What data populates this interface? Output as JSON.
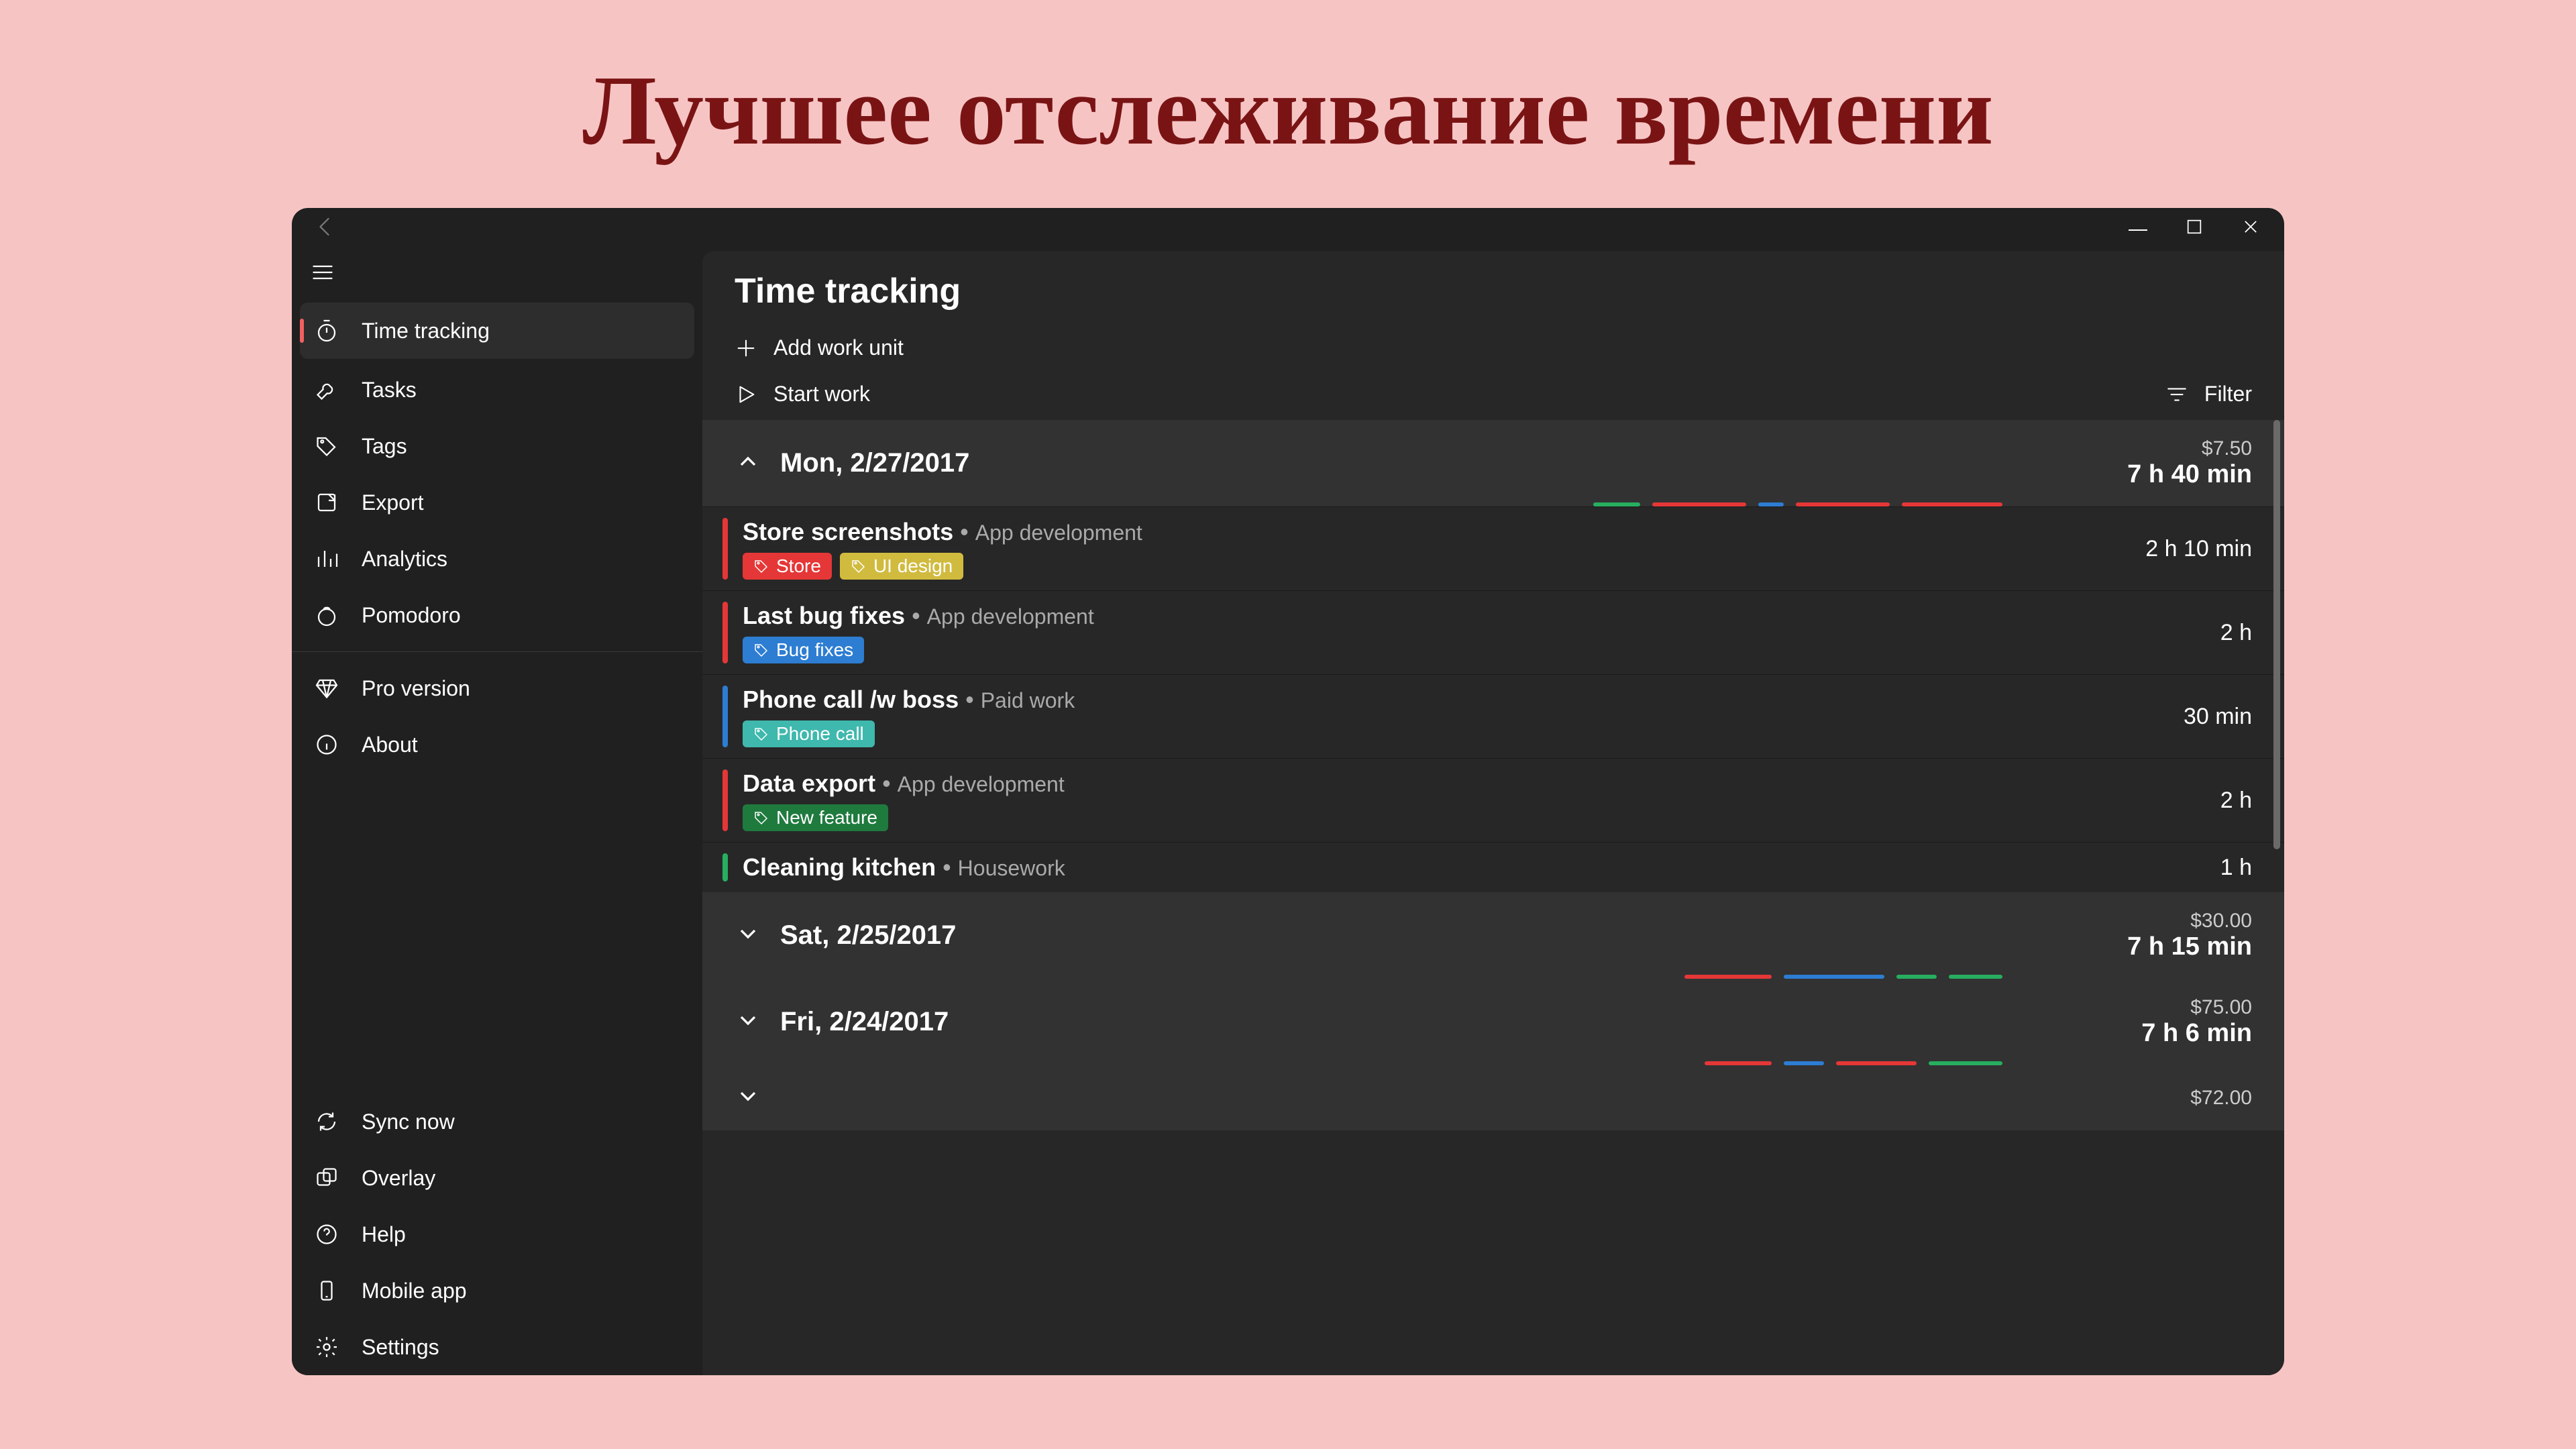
{
  "page_heading": "Лучшее отслеживание времени",
  "sidebar": {
    "main_nav": [
      {
        "id": "time-tracking",
        "label": "Time tracking",
        "icon": "stopwatch"
      },
      {
        "id": "tasks",
        "label": "Tasks",
        "icon": "wrench"
      },
      {
        "id": "tags",
        "label": "Tags",
        "icon": "tag"
      },
      {
        "id": "export",
        "label": "Export",
        "icon": "export"
      },
      {
        "id": "analytics",
        "label": "Analytics",
        "icon": "bars"
      },
      {
        "id": "pomodoro",
        "label": "Pomodoro",
        "icon": "pomodoro"
      }
    ],
    "secondary_nav": [
      {
        "id": "pro",
        "label": "Pro version",
        "icon": "diamond"
      },
      {
        "id": "about",
        "label": "About",
        "icon": "info"
      }
    ],
    "bottom_nav": [
      {
        "id": "sync",
        "label": "Sync now",
        "icon": "sync"
      },
      {
        "id": "overlay",
        "label": "Overlay",
        "icon": "overlay"
      },
      {
        "id": "help",
        "label": "Help",
        "icon": "help"
      },
      {
        "id": "mobile",
        "label": "Mobile app",
        "icon": "phone"
      },
      {
        "id": "settings",
        "label": "Settings",
        "icon": "gear"
      }
    ]
  },
  "main": {
    "title": "Time tracking",
    "add_work_unit": "Add work unit",
    "start_work": "Start work",
    "filter": "Filter"
  },
  "colors": {
    "red": "#e53737",
    "yellow": "#d1bb3f",
    "blue": "#2d7dd2",
    "teal": "#3fb8ad",
    "darkgreen": "#1f7a3e",
    "green": "#27ae60"
  },
  "days": [
    {
      "expanded": true,
      "date": "Mon, 2/27/2017",
      "price": "$7.50",
      "duration": "7 h 40 min",
      "bars": [
        {
          "color": "green",
          "w": 70
        },
        {
          "color": "red",
          "w": 140
        },
        {
          "color": "blue",
          "w": 38
        },
        {
          "color": "red",
          "w": 140
        },
        {
          "color": "red",
          "w": 150
        }
      ],
      "entries": [
        {
          "stripe": "red",
          "title": "Store screenshots",
          "project": "App development",
          "duration": "2 h 10 min",
          "tags": [
            {
              "color": "red",
              "label": "Store"
            },
            {
              "color": "yellow",
              "label": "UI design"
            }
          ]
        },
        {
          "stripe": "red",
          "title": "Last bug fixes",
          "project": "App development",
          "duration": "2 h",
          "tags": [
            {
              "color": "blue",
              "label": "Bug fixes"
            }
          ]
        },
        {
          "stripe": "blue",
          "title": "Phone call /w boss",
          "project": "Paid work",
          "duration": "30 min",
          "tags": [
            {
              "color": "teal",
              "label": "Phone call"
            }
          ]
        },
        {
          "stripe": "red",
          "title": "Data export",
          "project": "App development",
          "duration": "2 h",
          "tags": [
            {
              "color": "darkgreen",
              "label": "New feature"
            }
          ]
        },
        {
          "stripe": "green",
          "title": "Cleaning kitchen",
          "project": "Housework",
          "duration": "1 h",
          "tags": []
        }
      ]
    },
    {
      "expanded": false,
      "date": "Sat, 2/25/2017",
      "price": "$30.00",
      "duration": "7 h 15 min",
      "bars": [
        {
          "color": "red",
          "w": 130
        },
        {
          "color": "blue",
          "w": 150
        },
        {
          "color": "green",
          "w": 60
        },
        {
          "color": "green",
          "w": 80
        }
      ]
    },
    {
      "expanded": false,
      "date": "Fri, 2/24/2017",
      "price": "$75.00",
      "duration": "7 h 6 min",
      "bars": [
        {
          "color": "red",
          "w": 100
        },
        {
          "color": "blue",
          "w": 60
        },
        {
          "color": "red",
          "w": 120
        },
        {
          "color": "green",
          "w": 110
        }
      ]
    },
    {
      "expanded": false,
      "date": "",
      "price": "$72.00",
      "duration": "",
      "bars": []
    }
  ]
}
